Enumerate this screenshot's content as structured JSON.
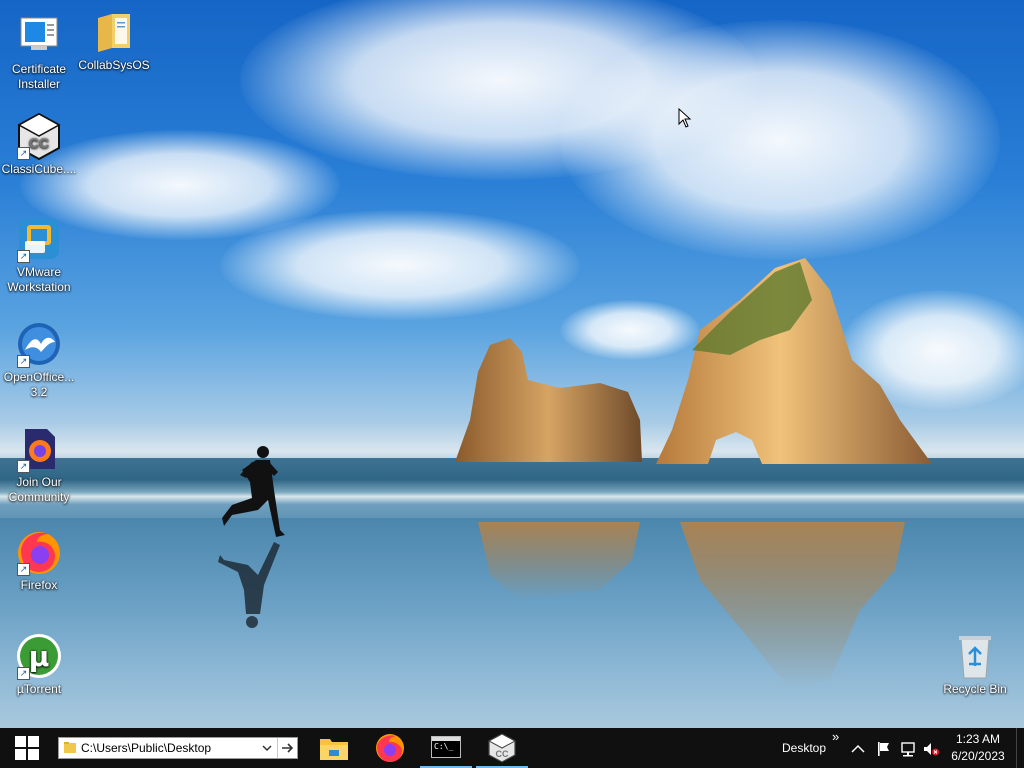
{
  "desktop": {
    "icons": [
      {
        "label": "Certificate Installer",
        "icon": "certificate-installer-icon",
        "shortcut": false
      },
      {
        "label": "CollabSysOS",
        "icon": "folder-icon",
        "shortcut": false
      },
      {
        "label": "ClassiCube....",
        "icon": "classicube-icon",
        "shortcut": true
      },
      {
        "label": "VMware Workstation",
        "icon": "vmware-icon",
        "shortcut": true
      },
      {
        "label": "OpenOffice... 3.2",
        "icon": "openoffice-icon",
        "shortcut": true
      },
      {
        "label": "Join Our Community",
        "icon": "firefox-doc-icon",
        "shortcut": true
      },
      {
        "label": "Firefox",
        "icon": "firefox-icon",
        "shortcut": true
      },
      {
        "label": "µTorrent",
        "icon": "utorrent-icon",
        "shortcut": true
      },
      {
        "label": "Recycle Bin",
        "icon": "recycle-bin-icon",
        "shortcut": false
      }
    ]
  },
  "taskbar": {
    "address_value": "C:\\Users\\Public\\Desktop",
    "desktop_toolbar_label": "Desktop",
    "overflow_glyph": "»",
    "clock_time": "1:23 AM",
    "clock_date": "6/20/2023",
    "pinned": [
      {
        "name": "file-explorer",
        "active": false
      },
      {
        "name": "firefox",
        "active": false
      },
      {
        "name": "command-prompt",
        "active": true
      },
      {
        "name": "classicube",
        "active": true
      }
    ],
    "command_prompt_glyph": "C:\\_"
  },
  "colors": {
    "taskbar_bg": "#101010",
    "active_underline": "#76b9ed",
    "accent": "#0078d7"
  }
}
